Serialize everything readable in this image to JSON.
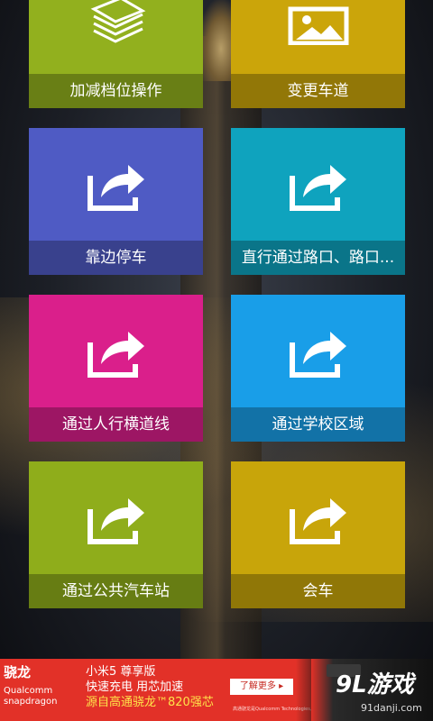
{
  "tiles": [
    {
      "label": "加减档位操作",
      "color": "#92b01e",
      "icon": "newspaper-icon"
    },
    {
      "label": "变更车道",
      "color": "#cba50a",
      "icon": "picture-icon"
    },
    {
      "label": "靠边停车",
      "color": "#4f5bc4",
      "icon": "share-arrow-icon"
    },
    {
      "label": "直行通过路口、路口...",
      "color": "#0fa3be",
      "icon": "share-arrow-icon"
    },
    {
      "label": "通过人行横道线",
      "color": "#da1f8b",
      "icon": "share-arrow-icon"
    },
    {
      "label": "通过学校区域",
      "color": "#199ee8",
      "icon": "share-arrow-icon"
    },
    {
      "label": "通过公共汽车站",
      "color": "#8fad1b",
      "icon": "share-arrow-icon"
    },
    {
      "label": "会车",
      "color": "#c8a50a",
      "icon": "share-arrow-icon"
    }
  ],
  "ad": {
    "brand": "骁龙",
    "brand_sub1": "Qualcomm",
    "brand_sub2": "snapdragon",
    "line1": "小米5 尊享版",
    "line2": "快速充电 用芯加速",
    "line3": "源自高通骁龙™820强芯",
    "more": "了解更多 ▸",
    "fine": "高通骁龙是Qualcomm Technologies, Inc.的产品",
    "logo": "9L游戏",
    "site": "91danji.com"
  }
}
